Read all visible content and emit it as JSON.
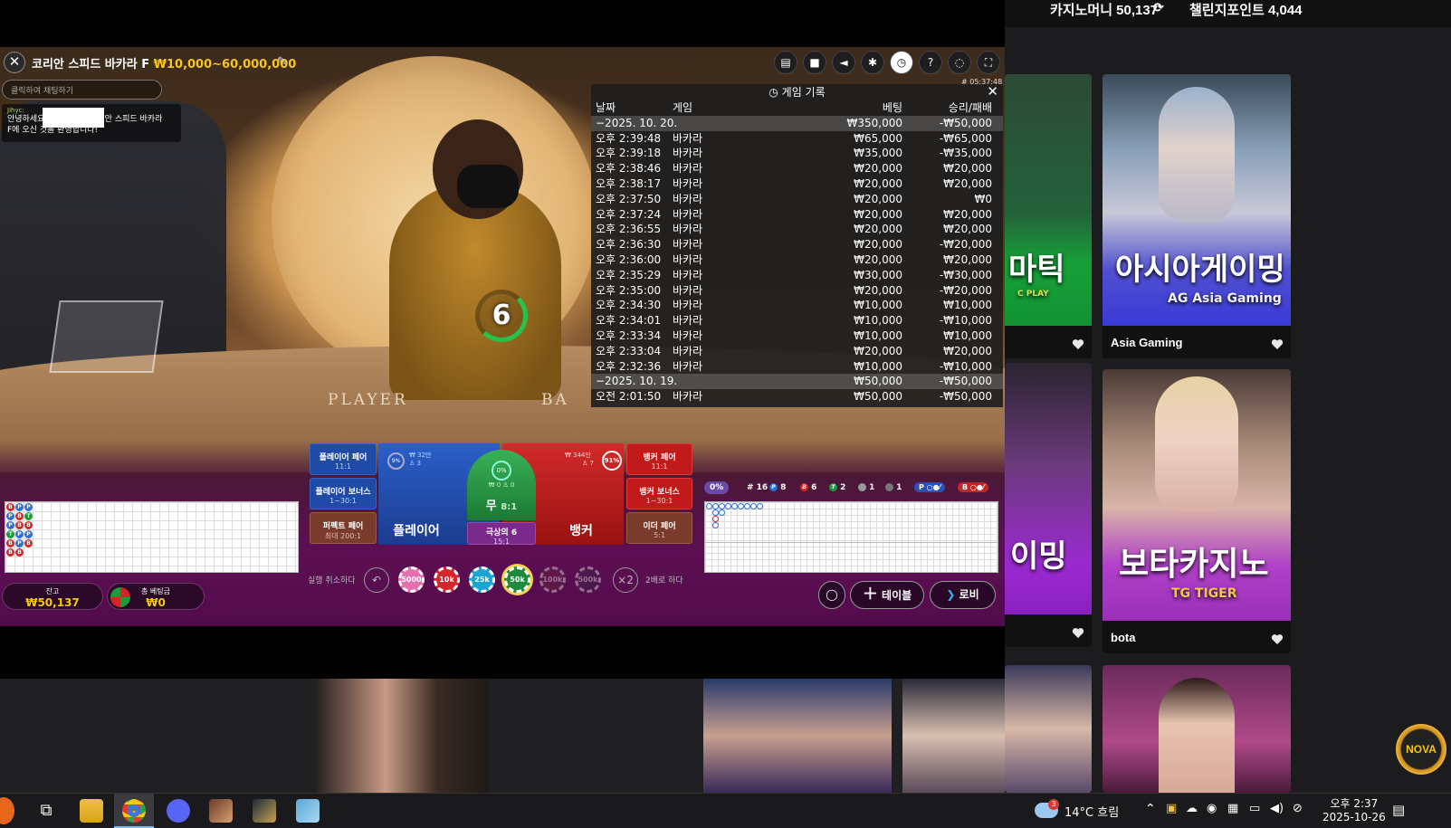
{
  "site": {
    "casino_money_label": "카지노머니 50,137",
    "challenge_points_label": "챌린지포인트 4,044",
    "cards": [
      {
        "name": "",
        "art_text": "마틱",
        "sub_text": "C PLAY",
        "color_top": "#2a6a3a",
        "color_bottom": "#16a038"
      },
      {
        "name": "Asia Gaming",
        "art_text": "아시아게이밍",
        "sub_text": "AG Asia Gaming",
        "color_top": "#4a6a8a",
        "color_bottom": "#3a3ad8"
      },
      {
        "name": "",
        "art_text": "이밍",
        "sub_text": "",
        "color_top": "#3a2a3a",
        "color_bottom": "#9a2ad0"
      },
      {
        "name": "bota",
        "art_text": "보타카지노",
        "sub_text": "TG TIGER",
        "color_top": "#6a5a5a",
        "color_bottom": "#b040c8"
      }
    ],
    "nova_badge": "NOVA"
  },
  "game": {
    "title": "코리안 스피드 바카라 F",
    "limit": "₩10,000~60,000,000",
    "timecode": "# 05:37:48",
    "chat_placeholder": "클릭하여 채팅하기",
    "chat_nick": "Jihyc:",
    "chat_text_a": "안녕하세요",
    "chat_text_b": "리안 스피드 바카라",
    "chat_text_c": "F에 오신 것을 환영합니다!",
    "timer": "6",
    "table_player": "PLAYER",
    "table_banker": "BA",
    "toolbar": [
      "chat-icon",
      "video-icon",
      "volume-icon",
      "settings-icon",
      "history-icon",
      "help-icon",
      "support-icon",
      "fullscreen-icon"
    ]
  },
  "history": {
    "title": "게임 기록",
    "headers": {
      "date": "날짜",
      "game": "게임",
      "bet": "베팅",
      "result": "승리/패배"
    },
    "rows": [
      {
        "date": "−2025. 10. 20.",
        "game": "",
        "bet": "₩350,000",
        "result": "-₩50,000",
        "group": true
      },
      {
        "date": "오후 2:39:48",
        "game": "바카라",
        "bet": "₩65,000",
        "result": "-₩65,000"
      },
      {
        "date": "오후 2:39:18",
        "game": "바카라",
        "bet": "₩35,000",
        "result": "-₩35,000"
      },
      {
        "date": "오후 2:38:46",
        "game": "바카라",
        "bet": "₩20,000",
        "result": "₩20,000"
      },
      {
        "date": "오후 2:38:17",
        "game": "바카라",
        "bet": "₩20,000",
        "result": "₩20,000"
      },
      {
        "date": "오후 2:37:50",
        "game": "바카라",
        "bet": "₩20,000",
        "result": "₩0"
      },
      {
        "date": "오후 2:37:24",
        "game": "바카라",
        "bet": "₩20,000",
        "result": "₩20,000"
      },
      {
        "date": "오후 2:36:55",
        "game": "바카라",
        "bet": "₩20,000",
        "result": "₩20,000"
      },
      {
        "date": "오후 2:36:30",
        "game": "바카라",
        "bet": "₩20,000",
        "result": "-₩20,000"
      },
      {
        "date": "오후 2:36:00",
        "game": "바카라",
        "bet": "₩20,000",
        "result": "₩20,000"
      },
      {
        "date": "오후 2:35:29",
        "game": "바카라",
        "bet": "₩30,000",
        "result": "-₩30,000"
      },
      {
        "date": "오후 2:35:00",
        "game": "바카라",
        "bet": "₩20,000",
        "result": "-₩20,000"
      },
      {
        "date": "오후 2:34:30",
        "game": "바카라",
        "bet": "₩10,000",
        "result": "₩10,000"
      },
      {
        "date": "오후 2:34:01",
        "game": "바카라",
        "bet": "₩10,000",
        "result": "-₩10,000"
      },
      {
        "date": "오후 2:33:34",
        "game": "바카라",
        "bet": "₩10,000",
        "result": "₩10,000"
      },
      {
        "date": "오후 2:33:04",
        "game": "바카라",
        "bet": "₩20,000",
        "result": "₩20,000"
      },
      {
        "date": "오후 2:32:36",
        "game": "바카라",
        "bet": "₩10,000",
        "result": "-₩10,000"
      },
      {
        "date": "−2025. 10. 19.",
        "game": "",
        "bet": "₩50,000",
        "result": "-₩50,000",
        "group": true
      },
      {
        "date": "오전 2:01:50",
        "game": "바카라",
        "bet": "₩50,000",
        "result": "-₩50,000"
      }
    ]
  },
  "bets": {
    "player_pair": "플레이어 페어",
    "player_pair_odds": "11:1",
    "player_bonus": "플레이어 보너스",
    "player_bonus_odds": "1~30:1",
    "perfect_pair": "퍼펙트 페어",
    "perfect_pair_odds": "최대 200:1",
    "banker_pair": "뱅커 페어",
    "banker_pair_odds": "11:1",
    "banker_bonus": "뱅커 보너스",
    "banker_bonus_odds": "1~30:1",
    "either_pair": "이더 페어",
    "either_pair_odds": "5:1",
    "player": "플레이어",
    "player_total": "₩ 32만",
    "player_count": "3",
    "player_pct": "9%",
    "banker": "뱅커",
    "banker_total": "₩ 344만",
    "banker_count": "7",
    "banker_pct": "91%",
    "tie": "무",
    "tie_odds": "8:1",
    "tie_total": "₩ 0",
    "tie_count": "0",
    "tie_pct": "0%",
    "super6": "극상의 6",
    "super6_odds": "15:1"
  },
  "stats": {
    "percent": "0%",
    "round": "# 16",
    "player": "8",
    "banker": "6",
    "tie": "2",
    "player_pair": "1",
    "banker_pair": "1",
    "p_predict": "P",
    "b_predict": "B"
  },
  "bead_road": [
    "B",
    "P",
    "P",
    "T",
    "B",
    "B",
    "P",
    "B",
    "B",
    "P",
    "P",
    "B",
    "P",
    "T",
    "B",
    "P",
    "B"
  ],
  "controls": {
    "undo_label": "실행 취소하다",
    "double_label": "2배로 하다",
    "double_icon": "×2",
    "chips": [
      {
        "label": "5000",
        "color": "#e46fb0",
        "dim": false,
        "selected": false
      },
      {
        "label": "10k",
        "color": "#d4262c",
        "dim": false,
        "selected": false
      },
      {
        "label": "25k",
        "color": "#19a4d4",
        "dim": false,
        "selected": false
      },
      {
        "label": "50k",
        "color": "#1e8a3c",
        "dim": false,
        "selected": true
      },
      {
        "label": "100k",
        "color": "#6a2a3a",
        "dim": true,
        "selected": false
      },
      {
        "label": "500k",
        "color": "#3a2a4a",
        "dim": true,
        "selected": false
      }
    ],
    "balance_label": "잔고",
    "balance": "₩50,137",
    "total_bet_label": "총 베팅금",
    "total_bet": "₩0",
    "table_btn": "테이블",
    "lobby_btn": "로비"
  },
  "taskbar": {
    "weather": "14°C 흐림",
    "time": "오후 2:37",
    "date": "2025-10-26",
    "notif_badge": "3"
  }
}
